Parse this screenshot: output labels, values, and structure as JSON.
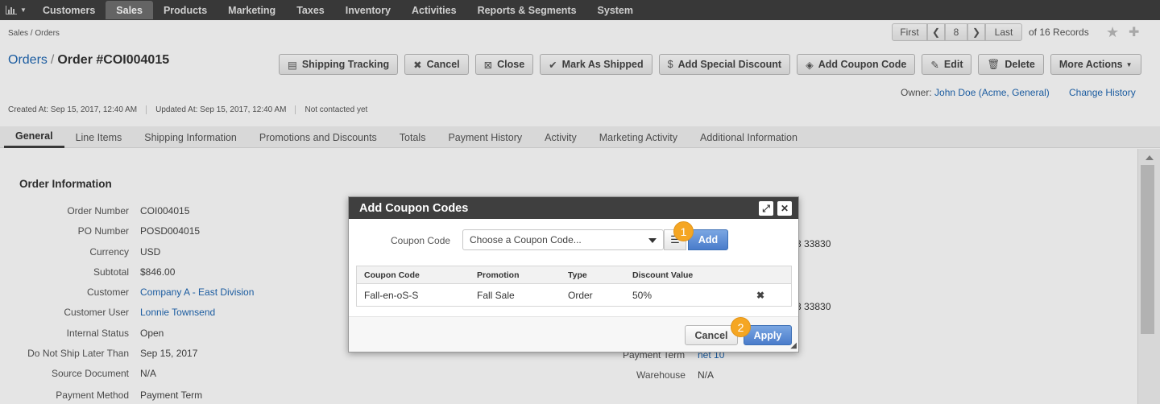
{
  "topnav": {
    "items": [
      "Customers",
      "Sales",
      "Products",
      "Marketing",
      "Taxes",
      "Inventory",
      "Activities",
      "Reports & Segments",
      "System"
    ],
    "active": "Sales"
  },
  "breadcrumb": "Sales / Orders",
  "pager": {
    "first": "First",
    "current": "8",
    "last": "Last",
    "records": "of 16 Records"
  },
  "title": {
    "link": "Orders",
    "sep": "/",
    "order": "Order #COI004015"
  },
  "actions": {
    "shipping_tracking": "Shipping Tracking",
    "cancel": "Cancel",
    "close": "Close",
    "mark_shipped": "Mark As Shipped",
    "add_discount": "Add Special Discount",
    "add_coupon": "Add Coupon Code",
    "edit": "Edit",
    "delete": "Delete",
    "more": "More Actions"
  },
  "owner": {
    "label": "Owner:",
    "name": "John Doe",
    "org": "(Acme, General)",
    "change_history": "Change History"
  },
  "meta": {
    "created": "Created At: Sep 15, 2017, 12:40 AM",
    "updated": "Updated At: Sep 15, 2017, 12:40 AM",
    "contacted": "Not contacted yet"
  },
  "tabs": [
    "General",
    "Line Items",
    "Shipping Information",
    "Promotions and Discounts",
    "Totals",
    "Payment History",
    "Activity",
    "Marketing Activity",
    "Additional Information"
  ],
  "order_info": {
    "title": "Order Information",
    "fields": [
      {
        "label": "Order Number",
        "value": "COI004015"
      },
      {
        "label": "PO Number",
        "value": "POSD004015"
      },
      {
        "label": "Currency",
        "value": "USD"
      },
      {
        "label": "Subtotal",
        "value": "$846.00"
      },
      {
        "label": "Customer",
        "value": "Company A - East Division"
      },
      {
        "label": "Customer User",
        "value": "Lonnie Townsend"
      },
      {
        "label": "Internal Status",
        "value": "Open"
      },
      {
        "label": "Do Not Ship Later Than",
        "value": "Sep 15, 2017"
      },
      {
        "label": "Source Document",
        "value": "N/A"
      },
      {
        "label": "Payment Method",
        "value": "Payment Term"
      }
    ]
  },
  "right_info": {
    "addr1_tail": "3 33830",
    "addr2_tail": "3 33830",
    "payment_term_label": "Payment Term",
    "payment_term_value": "net 10",
    "warehouse_label": "Warehouse",
    "warehouse_value": "N/A"
  },
  "dialog": {
    "title": "Add Coupon Codes",
    "coupon_label": "Coupon Code",
    "select_placeholder": "Choose a Coupon Code...",
    "add": "Add",
    "columns": [
      "Coupon Code",
      "Promotion",
      "Type",
      "Discount Value"
    ],
    "rows": [
      {
        "code": "Fall-en-oS-S",
        "promotion": "Fall Sale",
        "type": "Order",
        "discount": "50%"
      }
    ],
    "cancel": "Cancel",
    "apply": "Apply"
  },
  "badges": [
    "1",
    "2"
  ],
  "colors": {
    "nav_bg": "#3f3f3f",
    "link": "#1f67b3",
    "primary": "#4a7ccb",
    "badge": "#f5a623"
  }
}
